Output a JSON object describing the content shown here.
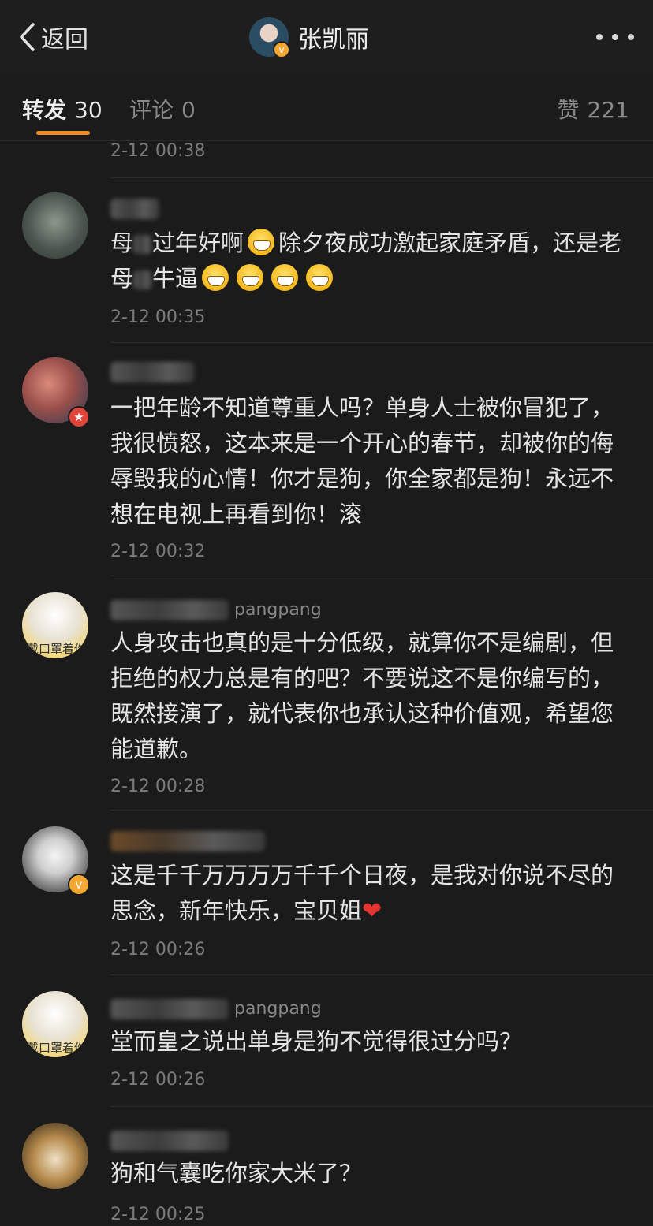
{
  "navbar": {
    "back_label": "返回",
    "title": "张凯丽"
  },
  "tabs": {
    "repost_label": "转发",
    "repost_count": "30",
    "comments_label": "评论",
    "comments_count": "0",
    "likes_label": "赞",
    "likes_count": "221"
  },
  "top_time": "2-12 00:38",
  "comments": [
    {
      "username": "",
      "text_parts": [
        "母",
        "过年好啊",
        "除夕夜成功激起家庭矛盾，还是老母",
        "牛逼"
      ],
      "time": "2-12 00:35"
    },
    {
      "username": "",
      "text": "一把年龄不知道尊重人吗？单身人士被你冒犯了，我很愤怒，这本来是一个开心的春节，却被你的侮辱毁我的心情！你才是狗，你全家都是狗！永远不想在电视上再看到你！滚",
      "time": "2-12 00:32"
    },
    {
      "username": "pangpang",
      "text": "人身攻击也真的是十分低级，就算你不是编剧，但拒绝的权力总是有的吧？不要说这不是你编写的，既然接演了，就代表你也承认这种价值观，希望您能道歉。",
      "time": "2-12 00:28"
    },
    {
      "username": "",
      "text": "这是千千万万万万千千个日夜，是我对你说不尽的思念，新年快乐，宝贝姐",
      "time": "2-12 00:26"
    },
    {
      "username": "pangpang",
      "text": "堂而皇之说出单身是狗不觉得很过分吗？",
      "time": "2-12 00:26"
    },
    {
      "username": "",
      "text": "狗和气囊吃你家大米了？",
      "time": "2-12 00:25"
    }
  ],
  "avatar_caption": "戴口罩着你",
  "colors": {
    "accent": "#f08a24",
    "background": "#1b1b1b",
    "verified": "#f3a832",
    "red_badge": "#e0453a"
  }
}
